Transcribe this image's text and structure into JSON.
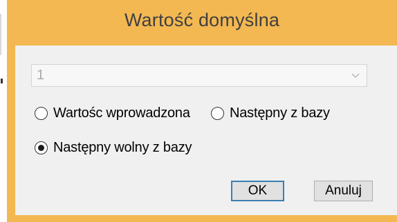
{
  "window": {
    "title": "Wartość domyślna",
    "frame_color": "#f3b852"
  },
  "combo": {
    "value": "1",
    "icon": "chevron-down-icon",
    "disabled": true
  },
  "radios": [
    {
      "label": "Wartośc wprowadzona",
      "checked": false
    },
    {
      "label": "Następny z bazy",
      "checked": false
    },
    {
      "label": "Następny wolny z bazy",
      "checked": true
    }
  ],
  "buttons": {
    "ok_label": "OK",
    "cancel_label": "Anuluj"
  }
}
